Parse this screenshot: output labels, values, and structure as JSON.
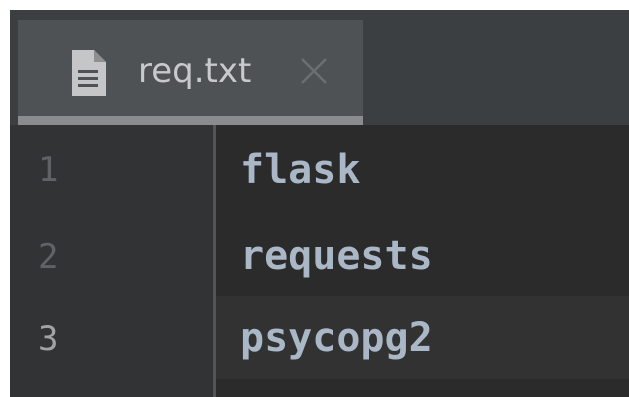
{
  "tab": {
    "label": "req.txt",
    "icon": "text-file-icon"
  },
  "editor": {
    "lines": [
      {
        "number": "1",
        "text": "flask"
      },
      {
        "number": "2",
        "text": "requests"
      },
      {
        "number": "3",
        "text": "psycopg2"
      }
    ],
    "current_line": 3
  },
  "colors": {
    "editor_bg": "#2b2b2b",
    "gutter_bg": "#313335",
    "tabbar_bg": "#3c3f41",
    "active_tab_bg": "#4e5254",
    "code_text": "#a9b7c6"
  }
}
